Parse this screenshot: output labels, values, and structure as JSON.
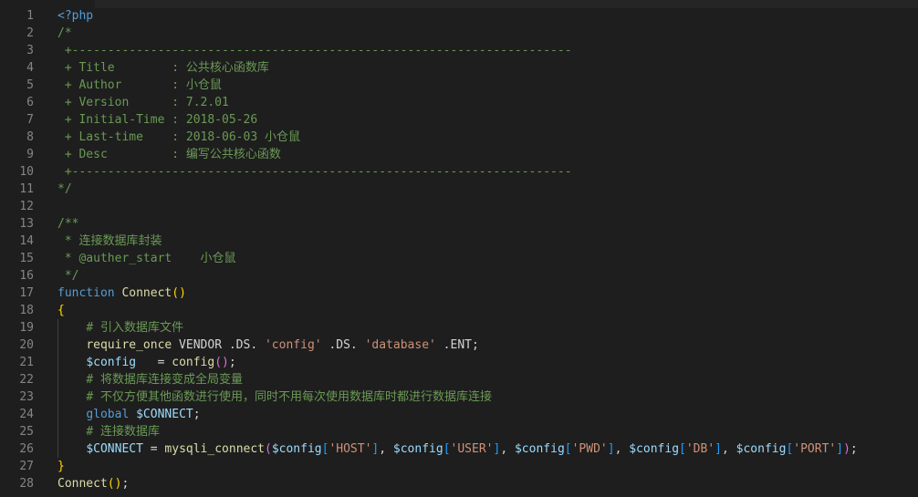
{
  "editor": {
    "language": "php",
    "colors": {
      "background": "#1e1e1e",
      "line_number": "#858585",
      "comment": "#6a9955",
      "keyword": "#569cd6",
      "function": "#dcdcaa",
      "variable": "#9cdcfe",
      "string": "#ce9178",
      "plain": "#d4d4d4",
      "bracket_level1": "#ffd700",
      "bracket_level2": "#da70d6",
      "bracket_level3": "#179fff"
    },
    "lines": [
      {
        "n": "1",
        "tokens": [
          [
            "tag",
            "<?php"
          ]
        ]
      },
      {
        "n": "2",
        "tokens": [
          [
            "comment",
            "/*"
          ]
        ]
      },
      {
        "n": "3",
        "tokens": [
          [
            "comment",
            " +----------------------------------------------------------------------"
          ]
        ]
      },
      {
        "n": "4",
        "tokens": [
          [
            "comment",
            " + Title        : 公共核心函数库"
          ]
        ]
      },
      {
        "n": "5",
        "tokens": [
          [
            "comment",
            " + Author       : 小仓鼠"
          ]
        ]
      },
      {
        "n": "6",
        "tokens": [
          [
            "comment",
            " + Version      : 7.2.01"
          ]
        ]
      },
      {
        "n": "7",
        "tokens": [
          [
            "comment",
            " + Initial-Time : 2018-05-26"
          ]
        ]
      },
      {
        "n": "8",
        "tokens": [
          [
            "comment",
            " + Last-time    : 2018-06-03 小仓鼠"
          ]
        ]
      },
      {
        "n": "9",
        "tokens": [
          [
            "comment",
            " + Desc         : 编写公共核心函数"
          ]
        ]
      },
      {
        "n": "10",
        "tokens": [
          [
            "comment",
            " +----------------------------------------------------------------------"
          ]
        ]
      },
      {
        "n": "11",
        "tokens": [
          [
            "comment",
            "*/"
          ]
        ]
      },
      {
        "n": "12",
        "tokens": []
      },
      {
        "n": "13",
        "tokens": [
          [
            "comment",
            "/**"
          ]
        ]
      },
      {
        "n": "14",
        "tokens": [
          [
            "comment",
            " * 连接数据库封装"
          ]
        ]
      },
      {
        "n": "15",
        "tokens": [
          [
            "comment",
            " * @auther_start    小仓鼠"
          ]
        ]
      },
      {
        "n": "16",
        "tokens": [
          [
            "comment",
            " */"
          ]
        ]
      },
      {
        "n": "17",
        "tokens": [
          [
            "keyword",
            "function"
          ],
          [
            "plain",
            " "
          ],
          [
            "func",
            "Connect"
          ],
          [
            "paren",
            "()"
          ]
        ]
      },
      {
        "n": "18",
        "tokens": [
          [
            "brace",
            "{"
          ]
        ]
      },
      {
        "n": "19",
        "tokens": [
          [
            "plain",
            "    "
          ],
          [
            "comment",
            "# 引入数据库文件"
          ]
        ]
      },
      {
        "n": "20",
        "tokens": [
          [
            "plain",
            "    "
          ],
          [
            "builtin",
            "require_once"
          ],
          [
            "plain",
            " VENDOR .DS. "
          ],
          [
            "string",
            "'config'"
          ],
          [
            "plain",
            " .DS. "
          ],
          [
            "string",
            "'database'"
          ],
          [
            "plain",
            " .ENT;"
          ]
        ]
      },
      {
        "n": "21",
        "tokens": [
          [
            "plain",
            "    "
          ],
          [
            "var",
            "$config"
          ],
          [
            "plain",
            "   = "
          ],
          [
            "func",
            "config"
          ],
          [
            "paren2",
            "()"
          ],
          [
            "plain",
            ";"
          ]
        ]
      },
      {
        "n": "22",
        "tokens": [
          [
            "plain",
            "    "
          ],
          [
            "comment",
            "# 将数据库连接变成全局变量"
          ]
        ]
      },
      {
        "n": "23",
        "tokens": [
          [
            "plain",
            "    "
          ],
          [
            "comment",
            "# 不仅方便其他函数进行使用，同时不用每次使用数据库时都进行数据库连接"
          ]
        ]
      },
      {
        "n": "24",
        "tokens": [
          [
            "plain",
            "    "
          ],
          [
            "keyword",
            "global"
          ],
          [
            "plain",
            " "
          ],
          [
            "var",
            "$CONNECT"
          ],
          [
            "plain",
            ";"
          ]
        ]
      },
      {
        "n": "25",
        "tokens": [
          [
            "plain",
            "    "
          ],
          [
            "comment",
            "# 连接数据库"
          ]
        ]
      },
      {
        "n": "26",
        "tokens": [
          [
            "plain",
            "    "
          ],
          [
            "var",
            "$CONNECT"
          ],
          [
            "plain",
            " = "
          ],
          [
            "func",
            "mysqli_connect"
          ],
          [
            "paren2",
            "("
          ],
          [
            "var",
            "$config"
          ],
          [
            "bracket",
            "["
          ],
          [
            "string",
            "'HOST'"
          ],
          [
            "bracket",
            "]"
          ],
          [
            "plain",
            ", "
          ],
          [
            "var",
            "$config"
          ],
          [
            "bracket",
            "["
          ],
          [
            "string",
            "'USER'"
          ],
          [
            "bracket",
            "]"
          ],
          [
            "plain",
            ", "
          ],
          [
            "var",
            "$config"
          ],
          [
            "bracket",
            "["
          ],
          [
            "string",
            "'PWD'"
          ],
          [
            "bracket",
            "]"
          ],
          [
            "plain",
            ", "
          ],
          [
            "var",
            "$config"
          ],
          [
            "bracket",
            "["
          ],
          [
            "string",
            "'DB'"
          ],
          [
            "bracket",
            "]"
          ],
          [
            "plain",
            ", "
          ],
          [
            "var",
            "$config"
          ],
          [
            "bracket",
            "["
          ],
          [
            "string",
            "'PORT'"
          ],
          [
            "bracket",
            "]"
          ],
          [
            "paren2",
            ")"
          ],
          [
            "plain",
            ";"
          ]
        ]
      },
      {
        "n": "27",
        "tokens": [
          [
            "brace",
            "}"
          ]
        ]
      },
      {
        "n": "28",
        "tokens": [
          [
            "func",
            "Connect"
          ],
          [
            "paren",
            "()"
          ],
          [
            "plain",
            ";"
          ]
        ]
      }
    ]
  }
}
